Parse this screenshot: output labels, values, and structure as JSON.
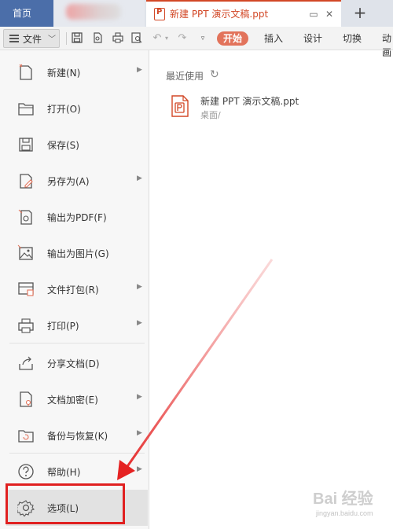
{
  "tabbar": {
    "home_label": "首页",
    "doc_tab_title": "新建 PPT 演示文稿.ppt",
    "new_tab_label": "+"
  },
  "toolbar": {
    "file_label": "文件",
    "ribbon_tabs": [
      "开始",
      "插入",
      "设计",
      "切换",
      "动画"
    ]
  },
  "menu": {
    "items": [
      {
        "label": "新建(N)",
        "icon": "new-file-icon",
        "submenu": true
      },
      {
        "label": "打开(O)",
        "icon": "folder-open-icon",
        "submenu": false
      },
      {
        "label": "保存(S)",
        "icon": "save-icon",
        "submenu": false
      },
      {
        "label": "另存为(A)",
        "icon": "save-as-icon",
        "submenu": true
      },
      {
        "label": "输出为PDF(F)",
        "icon": "export-pdf-icon",
        "submenu": false
      },
      {
        "label": "输出为图片(G)",
        "icon": "export-image-icon",
        "submenu": false
      },
      {
        "label": "文件打包(R)",
        "icon": "package-icon",
        "submenu": true
      },
      {
        "label": "打印(P)",
        "icon": "printer-icon",
        "submenu": true
      },
      {
        "label": "分享文档(D)",
        "icon": "share-icon",
        "submenu": false
      },
      {
        "label": "文档加密(E)",
        "icon": "encrypt-icon",
        "submenu": true
      },
      {
        "label": "备份与恢复(K)",
        "icon": "backup-icon",
        "submenu": true
      },
      {
        "label": "帮助(H)",
        "icon": "help-icon",
        "submenu": true
      },
      {
        "label": "选项(L)",
        "icon": "gear-icon",
        "submenu": false
      }
    ]
  },
  "recent": {
    "title": "最近使用",
    "files": [
      {
        "name": "新建 PPT 演示文稿.ppt",
        "path": "桌面/"
      }
    ]
  },
  "watermark": {
    "text": "Bai 经验",
    "sub": "jingyan.baidu.com"
  },
  "colors": {
    "accent": "#d24726",
    "home_tab": "#4b6ea9",
    "active_ribbon": "#e2735b",
    "highlight": "#e02020"
  }
}
